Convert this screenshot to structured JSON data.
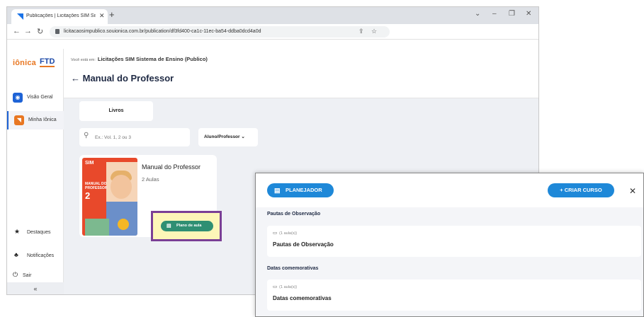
{
  "browser": {
    "tab_title": "Publicações | Licitações SIM Siste",
    "tab_close": "✕",
    "new_tab": "+",
    "url": "licitacaosimpublico.souionica.com.br/publication/df3fd400-ca1c-11ec-ba54-ddba0dcd4a0d",
    "win_controls": [
      "⌄",
      "–",
      "❐",
      "✕"
    ]
  },
  "sidebar": {
    "logo_text": "iônica",
    "logo_ftd": "FTD",
    "items": [
      {
        "label": "Visão Geral",
        "icon": "eye-icon",
        "color": "#1e63d6"
      },
      {
        "label": "Minha Iônica",
        "icon": "ionica-icon",
        "color": "#e87722"
      }
    ],
    "bottom_items": [
      {
        "label": "Destaques",
        "icon": "star-icon"
      },
      {
        "label": "Notificações",
        "icon": "bell-icon"
      },
      {
        "label": "Sair",
        "icon": "power-icon"
      }
    ],
    "collapse": "«"
  },
  "header": {
    "crumb_prefix": "Você está em:",
    "crumb_site": "Licitações SIM Sistema de Ensino (Publico)",
    "title": "Manual do Professor"
  },
  "content": {
    "tab_label": "Livros",
    "search_placeholder": "Ex.: Vol. 1, 2 ou 3",
    "filter_label": "Aluno/Professor",
    "card": {
      "title": "Manual do Professor",
      "subtitle": "2 Aulas",
      "cover_logo": "SIM",
      "cover_title": "MANUAL DO PROFESSOR",
      "cover_grade": "2",
      "plano_button": "Plano de aula"
    }
  },
  "panel": {
    "planejador": "PLANEJADOR",
    "criar": "+ CRIAR CURSO",
    "close": "✕",
    "sections": [
      {
        "label": "Pautas de Observação",
        "meta": "(1 aula(s))",
        "title": "Pautas de Observação"
      },
      {
        "label": "Datas comemorativas",
        "meta": "(1 aula(s))",
        "title": "Datas comemorativas"
      }
    ]
  },
  "colors": {
    "accent": "#1e88d8",
    "brand_orange": "#e87722",
    "highlight_border": "#7a3f95",
    "plano_green": "#2f8f73"
  }
}
